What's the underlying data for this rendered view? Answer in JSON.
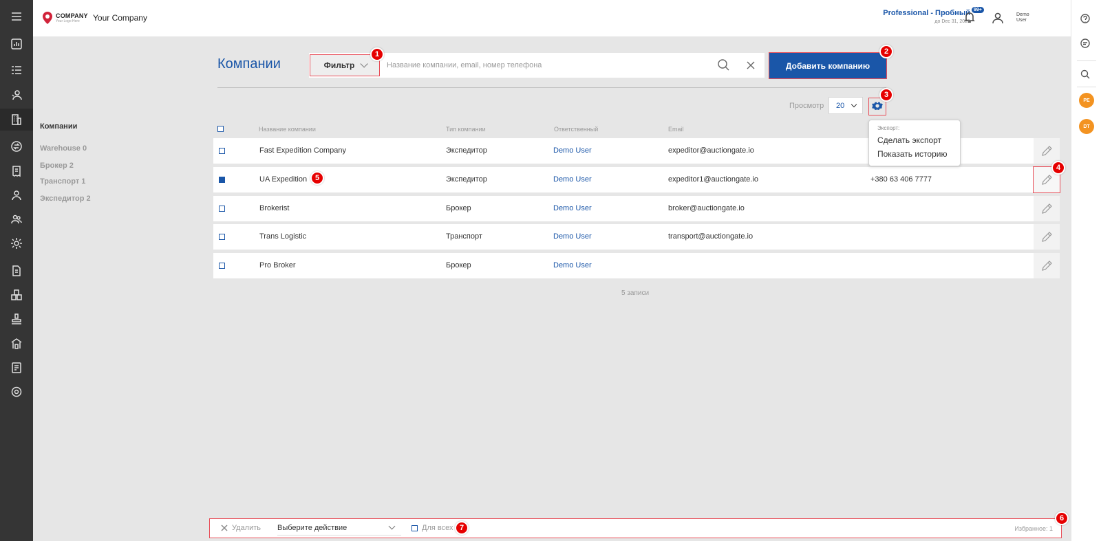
{
  "header": {
    "logo_text": "COMPANY",
    "logo_sub": "Your Logo Here",
    "company_name": "Your Company",
    "plan_title": "Professional - Пробный",
    "plan_date": "до Dec 31, 2025",
    "notifications_badge": "99+",
    "user_name": "Demo User"
  },
  "right_rail": {
    "avatars": [
      "PE",
      "DT"
    ]
  },
  "page": {
    "title": "Компании"
  },
  "search": {
    "filter_label": "Фильтр",
    "placeholder": "Название компании, email, номер телефона",
    "value": "",
    "add_button": "Добавить компанию"
  },
  "view": {
    "label": "Просмотр",
    "page_size": "20"
  },
  "export_menu": {
    "title": "Экспорт:",
    "items": [
      "Сделать экспорт",
      "Показать историю"
    ]
  },
  "subnav": {
    "title": "Компании",
    "items": [
      "Warehouse 0",
      "Брокер 2",
      "Транспорт 1",
      "Экспедитор 2"
    ]
  },
  "table": {
    "columns": [
      "Название компании",
      "Тип компании",
      "Ответственный",
      "Email"
    ],
    "rows": [
      {
        "name": "Fast Expedition Company",
        "type": "Экспедитор",
        "owner": "Demo User",
        "email": "expeditor@auctiongate.io",
        "phone": "",
        "checked": false
      },
      {
        "name": "UA Expedition",
        "type": "Экспедитор",
        "owner": "Demo User",
        "email": "expeditor1@auctiongate.io",
        "phone": "+380 63 406 7777",
        "checked": true
      },
      {
        "name": "Brokerist",
        "type": "Брокер",
        "owner": "Demo User",
        "email": "broker@auctiongate.io",
        "phone": "",
        "checked": false
      },
      {
        "name": "Trans Logistic",
        "type": "Транспорт",
        "owner": "Demo User",
        "email": "transport@auctiongate.io",
        "phone": "",
        "checked": false
      },
      {
        "name": "Pro Broker",
        "type": "Брокер",
        "owner": "Demo User",
        "email": "",
        "phone": "",
        "checked": false
      }
    ],
    "records_count": "5 записи"
  },
  "bottom_bar": {
    "delete_label": "Удалить",
    "action_placeholder": "Выберите действие",
    "for_all_label": "Для всех",
    "favorites": "Избранное: 1"
  },
  "annotations": [
    "1",
    "2",
    "3",
    "4",
    "5",
    "6",
    "7"
  ],
  "colors": {
    "accent": "#1a56a8",
    "sidebar": "#353535",
    "marker": "#e60000",
    "avatar": "#f39321"
  }
}
